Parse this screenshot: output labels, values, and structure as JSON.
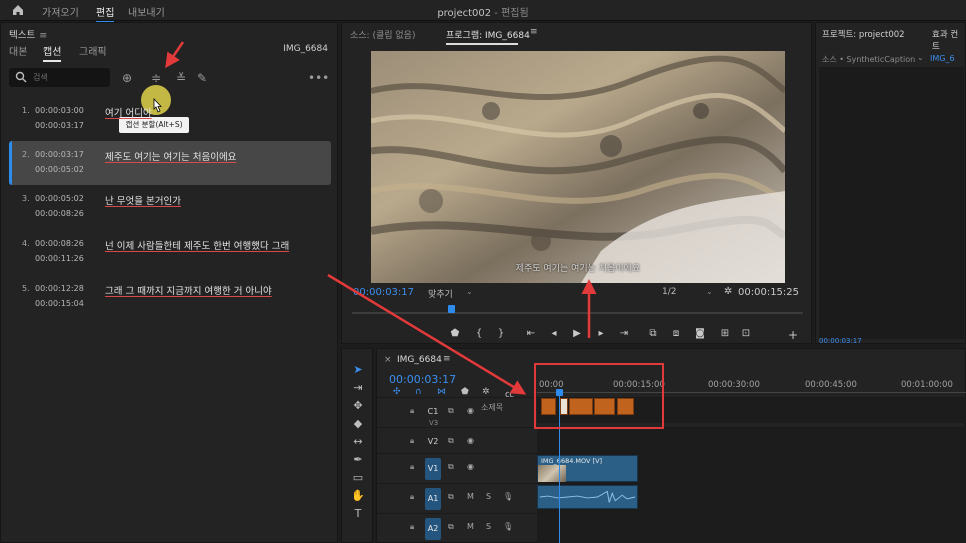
{
  "topbar": {
    "menu": [
      "가져오기",
      "편집",
      "내보내기"
    ],
    "active_menu": "편집",
    "project": "project002",
    "separator": " - ",
    "mode": "편집됨"
  },
  "left_panel": {
    "title": "텍스트",
    "tabs": [
      "대본",
      "캡션",
      "그래픽"
    ],
    "active_tab": "캡션",
    "clip_name": "IMG_6684",
    "search_placeholder": "검색",
    "tooltip": "캡션 분할(Alt+S)",
    "captions": [
      {
        "num": "1.",
        "in": "00:00:03:00",
        "out": "00:00:03:17",
        "text": "여기 어디야"
      },
      {
        "num": "2.",
        "in": "00:00:03:17",
        "out": "00:00:05:02",
        "text": "제주도 여기는 여기는 처음이에요"
      },
      {
        "num": "3.",
        "in": "00:00:05:02",
        "out": "00:00:08:26",
        "text": "난 무엇을 본거인가"
      },
      {
        "num": "4.",
        "in": "00:00:08:26",
        "out": "00:00:11:26",
        "text": "넌 이제 사람들한테 제주도 한번 여행했다     그래"
      },
      {
        "num": "5.",
        "in": "00:00:12:28",
        "out": "00:00:15:04",
        "text": "그래 그 때까지 지금까지 여행한 거 아니야"
      }
    ],
    "selected_index": 1
  },
  "monitor": {
    "source_label": "소스: (클립 없음)",
    "program_label": "프로그램: IMG_6684",
    "subtitle": "제주도 여기는 여기는 처음이에요",
    "current_tc": "00:00:03:17",
    "fit": "맞추기",
    "resolution": "1/2",
    "duration_tc": "00:00:15:25"
  },
  "project_panel": {
    "tab1": "프로젝트: project002",
    "tab2": "효과 컨트",
    "source_label": "소스 • SyntheticCaption",
    "clip_label": "IMG_6",
    "tc": "00:00:03:17"
  },
  "timeline": {
    "sequence": "IMG_6684",
    "current_tc": "00:00:03:17",
    "ruler": [
      "00:00",
      "00:00:15:00",
      "00:00:30:00",
      "00:00:45:00",
      "00:01:00:00"
    ],
    "caption_track_name": "소제목",
    "tracks": [
      "C1",
      "V2",
      "V1",
      "A1",
      "A2"
    ],
    "v1_clip_name": "IMG_6684.MOV [V]",
    "v3_label": "V3"
  },
  "colors": {
    "accent": "#2d8ceb",
    "annotation": "#e23a3a",
    "caption_clip": "#c0631d",
    "media_clip": "#2b5f86"
  }
}
